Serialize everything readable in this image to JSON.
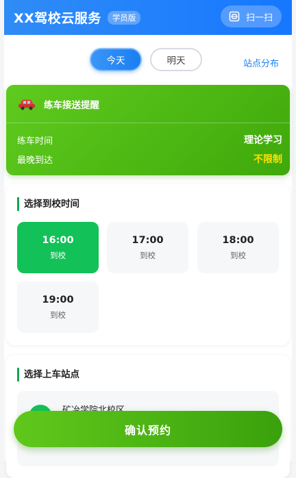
{
  "header": {
    "title": "XX驾校云服务",
    "badge": "学员版",
    "scan_label": "扫一扫",
    "scan_icon": "scan-icon"
  },
  "day_tabs": [
    {
      "label": "今天",
      "active": true
    },
    {
      "label": "明天",
      "active": false
    }
  ],
  "station_map_link": "站点分布",
  "reminder": {
    "icon": "car-icon",
    "title": "练车接送提醒",
    "rows": [
      {
        "label": "练车时间",
        "value": "理论学习"
      },
      {
        "label": "最晚到达",
        "value": "不限制"
      }
    ]
  },
  "time_section": {
    "title": "选择到校时间",
    "slots": [
      {
        "time": "16:00",
        "sub": "到校",
        "selected": true
      },
      {
        "time": "17:00",
        "sub": "到校",
        "selected": false
      },
      {
        "time": "18:00",
        "sub": "到校",
        "selected": false
      },
      {
        "time": "19:00",
        "sub": "到校",
        "selected": false
      }
    ]
  },
  "station_section": {
    "title": "选择上车站点",
    "items": [
      {
        "name": "矿冶学院北校区"
      }
    ]
  },
  "confirm_label": "确认预约",
  "colors": {
    "primary_blue": "#1677ff",
    "accent_green": "#12c157",
    "reminder_green": "#4fb814",
    "highlight_yellow": "#ffe100"
  }
}
